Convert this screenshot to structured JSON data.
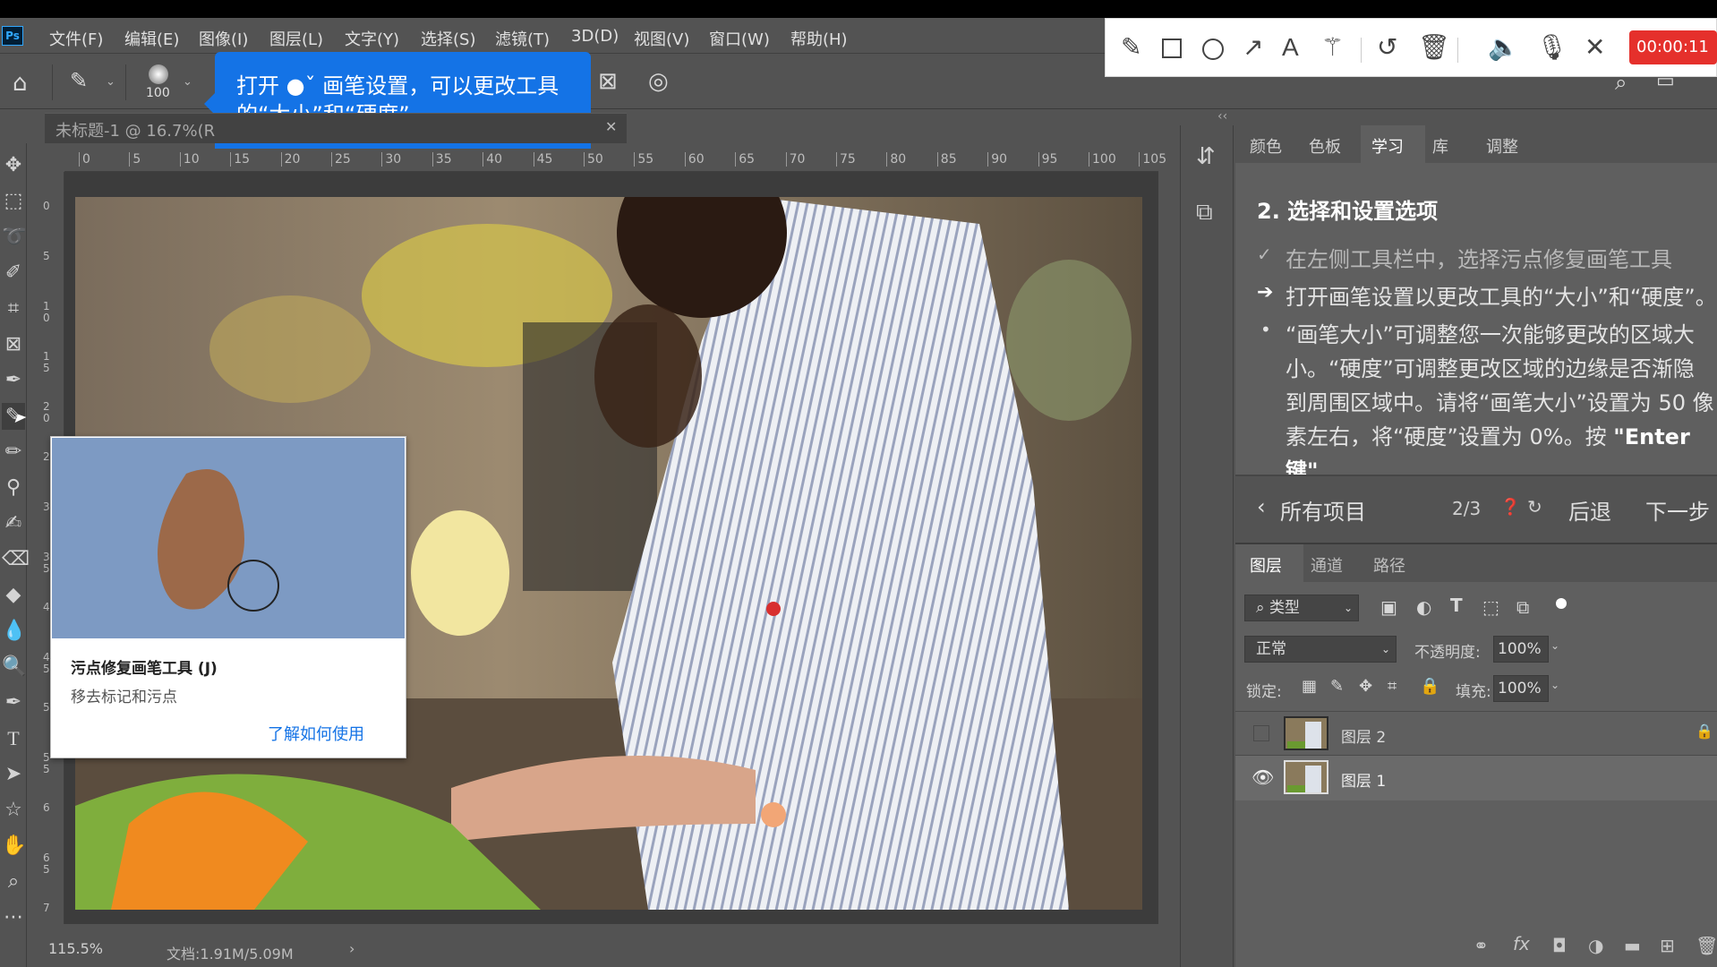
{
  "app": {
    "logo": "Ps"
  },
  "menu": [
    "文件(F)",
    "编辑(E)",
    "图像(I)",
    "图层(L)",
    "文字(Y)",
    "选择(S)",
    "滤镜(T)",
    "3D(D)",
    "视图(V)",
    "窗口(W)",
    "帮助(H)"
  ],
  "options_bar": {
    "brush_size": "100"
  },
  "coach_tooltip": {
    "text_line1": "打开 ●ˇ 画笔设置，可以更改工具",
    "text_line2": "的“大小”和“硬度”。"
  },
  "recorder": {
    "timer": "00:00:11"
  },
  "document": {
    "tab_title": "未标题-1 @ 16.7%(R",
    "zoom": "115.5%",
    "doc_info": "文档:1.91M/5.09M"
  },
  "ruler": {
    "h_ticks": [
      "0",
      "5",
      "10",
      "15",
      "20",
      "25",
      "30",
      "35",
      "40",
      "45",
      "50",
      "55",
      "60",
      "65",
      "70",
      "75",
      "80",
      "85",
      "90",
      "95",
      "100",
      "105"
    ],
    "v_ticks": [
      "0",
      "5",
      "1\n0",
      "1\n5",
      "2\n0",
      "2",
      "3",
      "3\n5",
      "4",
      "4\n5",
      "5",
      "5\n5",
      "6",
      "6\n5",
      "7"
    ]
  },
  "tool_tip": {
    "title": "污点修复画笔工具 (J)",
    "description": "移去标记和污点",
    "link": "了解如何使用"
  },
  "learn_panel": {
    "tabs": [
      "颜色",
      "色板",
      "学习",
      "库",
      "调整"
    ],
    "step_title": "2. 选择和设置选项",
    "check_item": "在左侧工具栏中，选择污点修复画笔工具",
    "arrow_item": "打开画笔设置以更改工具的“大小”和“硬度”。",
    "bullet_line1": "“画笔大小”可调整您一次能够更改的区域大",
    "bullet_line2": "小。“硬度”可调整更改区域的边缘是否渐隐",
    "bullet_line3": "到周围区域中。请将“画笔大小”设置为 50 像",
    "bullet_line4a": "素左右，将“硬度”设置为 0%。按 ",
    "bullet_line4b": "\"Enter",
    "bullet_line5": "键\"",
    "nav_all": "所有项目",
    "nav_progress": "2/3",
    "nav_back": "后退",
    "nav_next": "下一步"
  },
  "layers_panel": {
    "tabs": [
      "图层",
      "通道",
      "路径"
    ],
    "filter_label": "类型",
    "blend_mode": "正常",
    "opacity_label": "不透明度:",
    "opacity_value": "100%",
    "lock_label": "锁定:",
    "fill_label": "填充:",
    "fill_value": "100%",
    "layers": [
      {
        "name": "图层 2",
        "visible": false,
        "locked": true
      },
      {
        "name": "图层 1",
        "visible": true,
        "selected": true
      }
    ]
  },
  "colors": {
    "accent": "#1473e6",
    "panel": "#535353",
    "timer": "#e5302c"
  }
}
